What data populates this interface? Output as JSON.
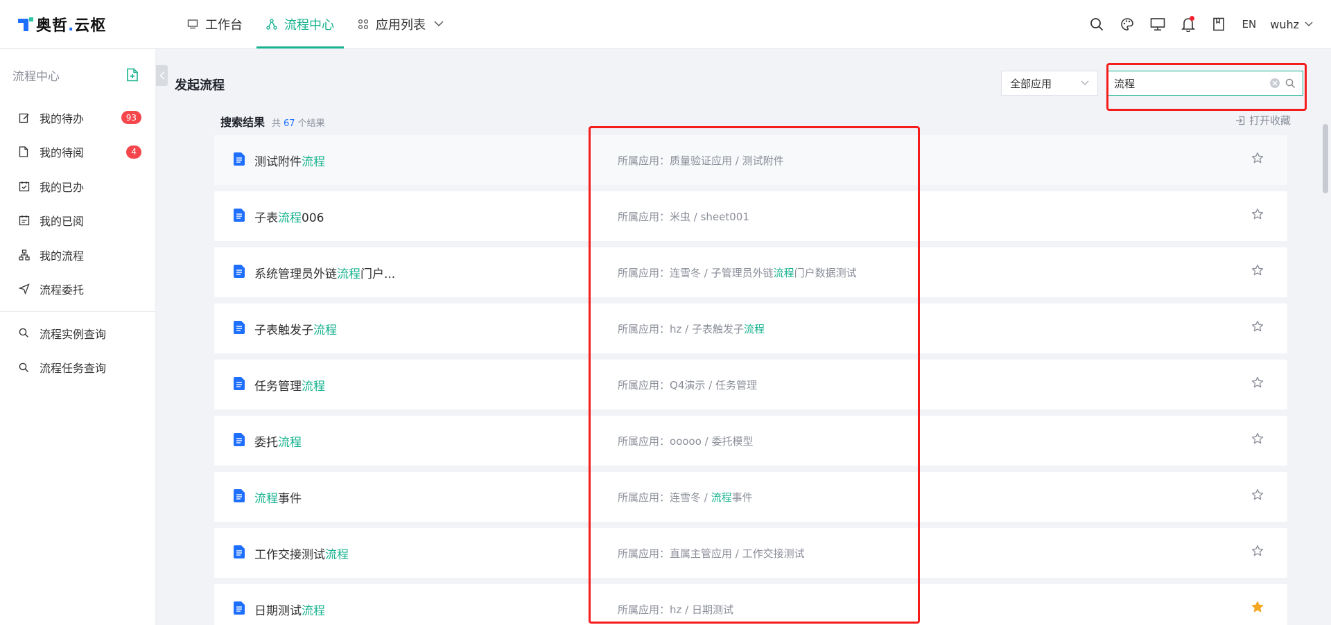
{
  "brand": {
    "name_a": "奥哲",
    "dot": ".",
    "name_b": "云枢"
  },
  "nav": {
    "items": [
      {
        "label": "工作台",
        "icon": "monitor-icon"
      },
      {
        "label": "流程中心",
        "icon": "flow-icon"
      },
      {
        "label": "应用列表",
        "icon": "apps-grid-icon"
      }
    ]
  },
  "topbar": {
    "lang": "EN",
    "user": "wuhz"
  },
  "sidebar": {
    "title": "流程中心",
    "items": [
      {
        "label": "我的待办",
        "badge": "93",
        "icon": "edit-icon"
      },
      {
        "label": "我的待阅",
        "badge": "4",
        "icon": "document-icon"
      },
      {
        "label": "我的已办",
        "icon": "check-calendar-icon"
      },
      {
        "label": "我的已阅",
        "icon": "read-calendar-icon"
      },
      {
        "label": "我的流程",
        "icon": "org-chart-icon"
      },
      {
        "label": "流程委托",
        "icon": "send-icon"
      }
    ],
    "queries": [
      {
        "label": "流程实例查询",
        "icon": "search-icon"
      },
      {
        "label": "流程任务查询",
        "icon": "search-icon"
      }
    ]
  },
  "main": {
    "title": "发起流程",
    "app_filter": "全部应用",
    "search_value": "流程",
    "results_title": "搜索结果",
    "count_prefix": "共",
    "count": "67",
    "count_suffix": "个结果",
    "open_fav": "打开收藏",
    "app_prefix": "所属应用："
  },
  "results": [
    {
      "name": [
        "测试附件",
        "流程"
      ],
      "app": [
        "质量验证应用 / 测试附件"
      ],
      "starred": false
    },
    {
      "name": [
        "子表",
        "流程",
        "006"
      ],
      "app": [
        "米虫 / sheet001"
      ],
      "starred": false
    },
    {
      "name": [
        "系统管理员外链",
        "流程",
        "门户..."
      ],
      "app": [
        "连雪冬 / 子管理员外链",
        "流程",
        "门户数据测试"
      ],
      "starred": false
    },
    {
      "name": [
        "子表触发子",
        "流程"
      ],
      "app": [
        "hz / 子表触发子",
        "流程"
      ],
      "starred": false
    },
    {
      "name": [
        "任务管理",
        "流程"
      ],
      "app": [
        "Q4演示 / 任务管理"
      ],
      "starred": false
    },
    {
      "name": [
        "委托",
        "流程"
      ],
      "app": [
        "ooooo / 委托模型"
      ],
      "starred": false
    },
    {
      "name": [
        "",
        "流程",
        "事件"
      ],
      "app": [
        "连雪冬 / ",
        "流程",
        "事件"
      ],
      "starred": false
    },
    {
      "name": [
        "工作交接测试",
        "流程"
      ],
      "app": [
        "直属主管应用 / 工作交接测试"
      ],
      "starred": false
    },
    {
      "name": [
        "日期测试",
        "流程"
      ],
      "app": [
        "hz / 日期测试"
      ],
      "starred": true
    }
  ],
  "colors": {
    "accent": "#17b28f",
    "brand_blue": "#1f6fff",
    "badge": "#f5464b",
    "star_active": "#f5a623",
    "annotation": "#f51c1c"
  }
}
